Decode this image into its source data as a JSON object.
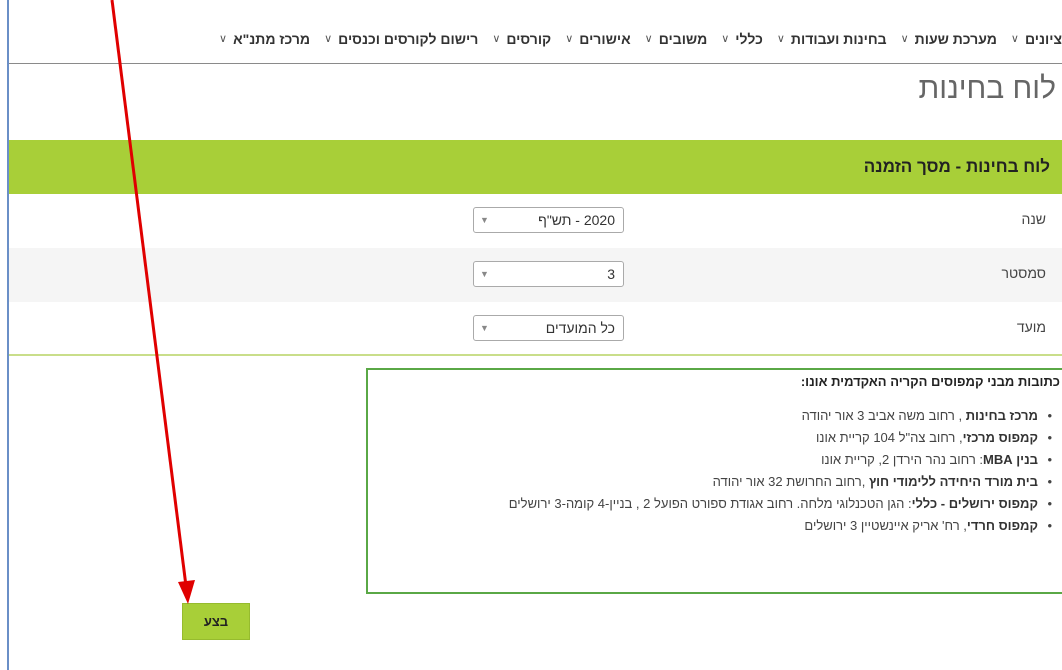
{
  "nav": {
    "items": [
      {
        "label": "ציונים"
      },
      {
        "label": "מערכת שעות"
      },
      {
        "label": "בחינות ועבודות"
      },
      {
        "label": "כללי"
      },
      {
        "label": "משובים"
      },
      {
        "label": "אישורים"
      },
      {
        "label": "קורסים"
      },
      {
        "label": "רישום לקורסים וכנסים"
      },
      {
        "label": "מרכז מתנ\"א"
      }
    ],
    "chevron": "∨"
  },
  "page": {
    "title": "לוח בחינות"
  },
  "panel": {
    "title": "לוח בחינות - מסך הזמנה"
  },
  "form": {
    "year": {
      "label": "שנה",
      "value": "2020 - תש\"ף"
    },
    "semester": {
      "label": "סמסטר",
      "value": "3"
    },
    "session": {
      "label": "מועד",
      "value": "כל המועדים"
    },
    "dropdown_arrow": "▼"
  },
  "info": {
    "heading": "כתובות מבני קמפוסים הקריה האקדמית אונו:",
    "items": [
      {
        "bold": "מרכז בחינות",
        "text": " , רחוב משה אביב 3 אור יהודה"
      },
      {
        "bold": "קמפוס מרכזי",
        "text": ", רחוב צה\"ל 104 קריית אונו"
      },
      {
        "bold": "בנין MBA",
        "text": ": רחוב נהר הירדן 2, קריית אונו"
      },
      {
        "bold": "בית מורד היחידה ללימודי חוץ",
        "text": " ,רחוב החרושת 32 אור יהודה"
      },
      {
        "bold": "קמפוס ירושלים - כללי",
        "text": ": הגן הטכנלוגי מלחה. רחוב אגודת ספורט הפועל 2 , בניין-4 קומה-3 ירושלים"
      },
      {
        "bold": "קמפוס חרדי",
        "text": ", רח' אריק איינשטיין 3 ירושלים"
      }
    ]
  },
  "actions": {
    "run_label": "בצע"
  },
  "colors": {
    "accent_green": "#a8cf38",
    "box_border": "#5aa846",
    "annotation_arrow": "#e00000"
  }
}
